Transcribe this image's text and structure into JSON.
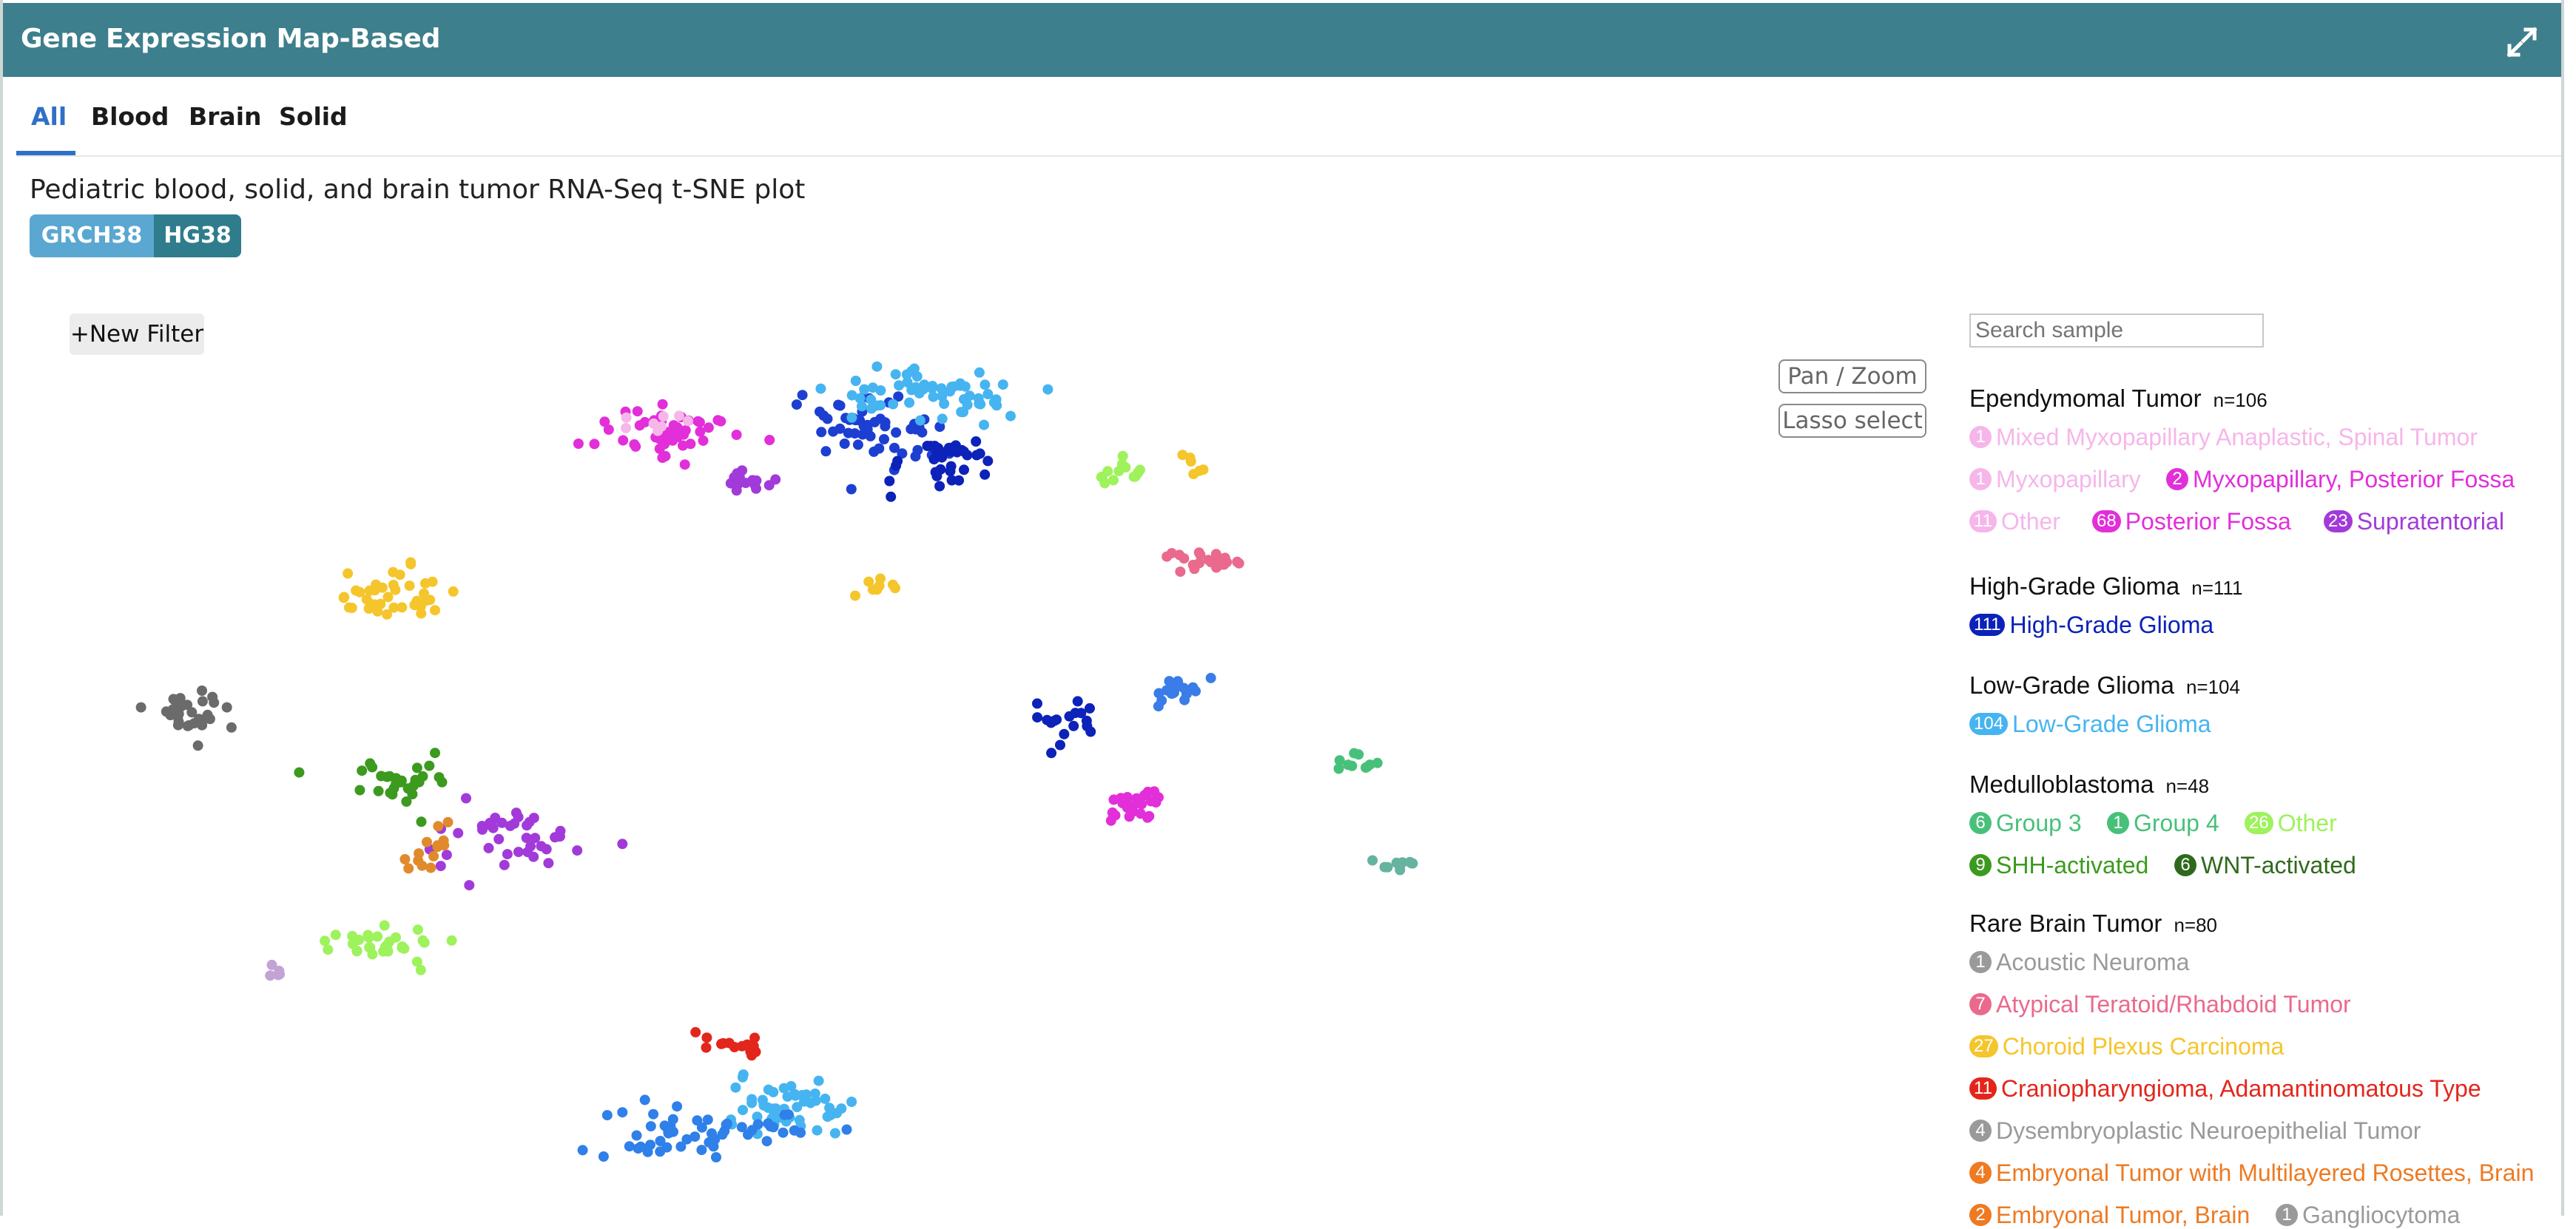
{
  "header": {
    "title": "Gene Expression Map-Based",
    "expand_icon": "expand-icon"
  },
  "tabs": [
    {
      "label": "All",
      "active": true
    },
    {
      "label": "Blood",
      "active": false
    },
    {
      "label": "Brain",
      "active": false
    },
    {
      "label": "Solid",
      "active": false
    }
  ],
  "subtitle": "Pediatric blood, solid, and brain tumor RNA-Seq t-SNE plot",
  "genome_badges": [
    "GRCH38",
    "HG38"
  ],
  "controls": {
    "new_filter": "+New Filter",
    "pan_zoom": "Pan / Zoom",
    "lasso_select": "Lasso select",
    "search_placeholder": "Search sample"
  },
  "legend": [
    {
      "name": "Ependymomal Tumor",
      "n": "n=106",
      "items": [
        {
          "count": "1",
          "label": "Mixed Myxopapillary Anaplastic, Spinal Tumor",
          "color": "#f6b6ea"
        },
        {
          "count": "1",
          "label": "Myxopapillary",
          "color": "#f6b6ea"
        },
        {
          "count": "2",
          "label": "Myxopapillary, Posterior Fossa",
          "color": "#e22fd9"
        },
        {
          "count": "11",
          "label": "Other",
          "color": "#f6b6ea"
        },
        {
          "count": "68",
          "label": "Posterior Fossa",
          "color": "#e22fd9"
        },
        {
          "count": "23",
          "label": "Supratentorial",
          "color": "#a23ad9"
        }
      ]
    },
    {
      "name": "High-Grade Glioma",
      "n": "n=111",
      "items": [
        {
          "count": "111",
          "label": "High-Grade Glioma",
          "color": "#0c22b8"
        }
      ]
    },
    {
      "name": "Low-Grade Glioma",
      "n": "n=104",
      "items": [
        {
          "count": "104",
          "label": "Low-Grade Glioma",
          "color": "#46b4f0"
        }
      ]
    },
    {
      "name": "Medulloblastoma",
      "n": "n=48",
      "items": [
        {
          "count": "6",
          "label": "Group 3",
          "color": "#47c17a"
        },
        {
          "count": "1",
          "label": "Group 4",
          "color": "#47c17a"
        },
        {
          "count": "26",
          "label": "Other",
          "color": "#9ef25c"
        },
        {
          "count": "9",
          "label": "SHH-activated",
          "color": "#3c9a1e"
        },
        {
          "count": "6",
          "label": "WNT-activated",
          "color": "#2f6a1c"
        }
      ]
    },
    {
      "name": "Rare Brain Tumor",
      "n": "n=80",
      "items": [
        {
          "count": "1",
          "label": "Acoustic Neuroma",
          "color": "#9a9a9a"
        },
        {
          "count": "7",
          "label": "Atypical Teratoid/Rhabdoid Tumor",
          "color": "#e96a8d"
        },
        {
          "count": "27",
          "label": "Choroid Plexus Carcinoma",
          "color": "#f5c52c"
        },
        {
          "count": "11",
          "label": "Craniopharyngioma, Adamantinomatous Type",
          "color": "#e3261c"
        },
        {
          "count": "4",
          "label": "Dysembryoplastic Neuroepithelial Tumor",
          "color": "#9a9a9a"
        },
        {
          "count": "4",
          "label": "Embryonal Tumor with Multilayered Rosettes, Brain",
          "color": "#ee7a22"
        },
        {
          "count": "2",
          "label": "Embryonal Tumor, Brain",
          "color": "#ee7a22"
        },
        {
          "count": "1",
          "label": "Gangliocytoma",
          "color": "#9a9a9a"
        }
      ]
    }
  ],
  "chart_data": {
    "type": "scatter",
    "title": "Pediatric blood, solid, and brain tumor RNA-Seq t-SNE plot",
    "xlabel": "",
    "ylabel": "",
    "grid": false,
    "axes_visible": false,
    "xlim": [
      0,
      100
    ],
    "ylim": [
      0,
      100
    ],
    "legend_position": "right",
    "clusters": [
      {
        "label": "Posterior Fossa",
        "color": "#e22fd9",
        "cx": 34.6,
        "cy": 90.3,
        "sx": 1.8,
        "sy": 1.5,
        "n": 55
      },
      {
        "label": "Other (Ependymomal)",
        "color": "#f6b6ea",
        "cx": 33.6,
        "cy": 91.2,
        "sx": 0.8,
        "sy": 1.0,
        "n": 8
      },
      {
        "label": "Supratentorial",
        "color": "#a23ad9",
        "cx": 38.5,
        "cy": 84.5,
        "sx": 0.6,
        "sy": 0.6,
        "n": 14
      },
      {
        "label": "Supratentorial (lower)",
        "color": "#a23ad9",
        "cx": 26.6,
        "cy": 45.0,
        "sx": 2.0,
        "sy": 2.5,
        "n": 40
      },
      {
        "label": "High-Grade Glioma (upper)",
        "color": "#1c3fd1",
        "cx": 45.0,
        "cy": 90.5,
        "sx": 1.8,
        "sy": 2.2,
        "n": 55
      },
      {
        "label": "High-Grade Glioma (lower)",
        "color": "#0c22b8",
        "cx": 48.8,
        "cy": 86.8,
        "sx": 1.5,
        "sy": 1.4,
        "n": 35
      },
      {
        "label": "High-Grade Glioma (mid)",
        "color": "#0c22b8",
        "cx": 55.0,
        "cy": 57.0,
        "sx": 0.9,
        "sy": 1.2,
        "n": 18
      },
      {
        "label": "Low-Grade Glioma (upper)",
        "color": "#46b4f0",
        "cx": 47.8,
        "cy": 94.5,
        "sx": 2.3,
        "sy": 1.6,
        "n": 60
      },
      {
        "label": "Low-Grade Glioma (lower)",
        "color": "#46b4f0",
        "cx": 40.3,
        "cy": 12.5,
        "sx": 1.7,
        "sy": 1.6,
        "n": 50
      },
      {
        "label": "Choroid Plexus Carcinoma",
        "color": "#f5c52c",
        "cx": 20.4,
        "cy": 71.0,
        "sx": 1.5,
        "sy": 1.7,
        "n": 40
      },
      {
        "label": "Choroid Plexus Carcinoma (small)",
        "color": "#f5c52c",
        "cx": 44.8,
        "cy": 72.5,
        "sx": 0.6,
        "sy": 0.7,
        "n": 8
      },
      {
        "label": "Choroid Plexus Carcinoma (right)",
        "color": "#f5c52c",
        "cx": 61.5,
        "cy": 86.5,
        "sx": 0.5,
        "sy": 0.5,
        "n": 6
      },
      {
        "label": "Gray cluster",
        "color": "#6b6b6b",
        "cx": 9.5,
        "cy": 58.5,
        "sx": 1.0,
        "sy": 1.3,
        "n": 30
      },
      {
        "label": "Medulloblastoma SHH-activated",
        "color": "#3c9a1e",
        "cx": 21.0,
        "cy": 50.0,
        "sx": 1.6,
        "sy": 1.5,
        "n": 30
      },
      {
        "label": "Medulloblastoma Other",
        "color": "#9ef25c",
        "cx": 19.5,
        "cy": 31.5,
        "sx": 1.5,
        "sy": 1.0,
        "n": 30
      },
      {
        "label": "Medulloblastoma Other (right)",
        "color": "#9ef25c",
        "cx": 58.0,
        "cy": 85.5,
        "sx": 0.7,
        "sy": 0.8,
        "n": 14
      },
      {
        "label": "Group 3",
        "color": "#47c17a",
        "cx": 70.0,
        "cy": 52.0,
        "sx": 0.7,
        "sy": 0.6,
        "n": 10
      },
      {
        "label": "Embryonal Tumor",
        "color": "#e08a2c",
        "cx": 22.0,
        "cy": 42.0,
        "sx": 0.6,
        "sy": 1.3,
        "n": 14
      },
      {
        "label": "Atypical Teratoid/Rhabdoid Tumor",
        "color": "#e96a8d",
        "cx": 62.0,
        "cy": 75.5,
        "sx": 1.3,
        "sy": 0.6,
        "n": 22
      },
      {
        "label": "Craniopharyngioma",
        "color": "#e3261c",
        "cx": 37.8,
        "cy": 20.0,
        "sx": 0.9,
        "sy": 0.9,
        "n": 14
      },
      {
        "label": "Blue cluster (lower)",
        "color": "#2f80e8",
        "cx": 36.0,
        "cy": 10.0,
        "sx": 2.4,
        "sy": 1.6,
        "n": 55
      },
      {
        "label": "Pink cluster (mid)",
        "color": "#e22fd9",
        "cx": 58.5,
        "cy": 47.5,
        "sx": 0.8,
        "sy": 1.0,
        "n": 25
      },
      {
        "label": "Blue cluster (mid)",
        "color": "#3a7ce8",
        "cx": 60.8,
        "cy": 60.5,
        "sx": 0.9,
        "sy": 0.8,
        "n": 20
      },
      {
        "label": "Teal cluster",
        "color": "#66b3a0",
        "cx": 72.0,
        "cy": 40.5,
        "sx": 0.7,
        "sy": 0.4,
        "n": 10
      },
      {
        "label": "Lilac cluster",
        "color": "#c3a3d6",
        "cx": 14.0,
        "cy": 28.0,
        "sx": 0.5,
        "sy": 0.3,
        "n": 5
      }
    ]
  }
}
